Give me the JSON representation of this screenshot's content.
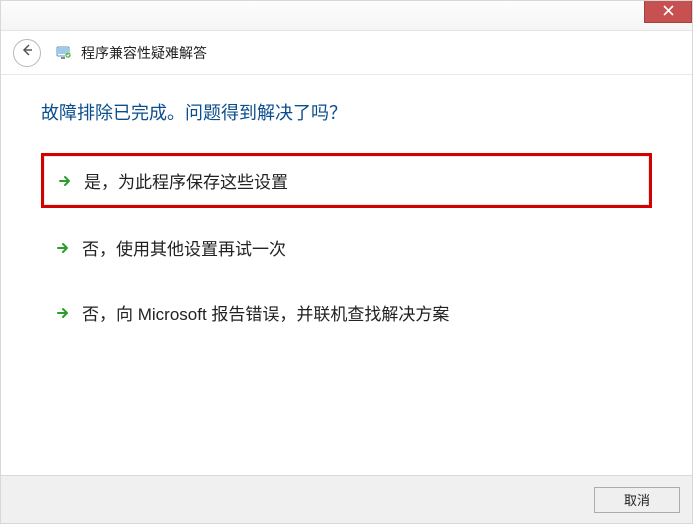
{
  "header": {
    "title": "程序兼容性疑难解答"
  },
  "content": {
    "question": "故障排除已完成。问题得到解决了吗？",
    "options": [
      {
        "label": "是，为此程序保存这些设置",
        "highlighted": true
      },
      {
        "label": "否，使用其他设置再试一次",
        "highlighted": false
      },
      {
        "label": "否，向 Microsoft 报告错误，并联机查找解决方案",
        "highlighted": false
      }
    ]
  },
  "footer": {
    "cancel_label": "取消"
  }
}
